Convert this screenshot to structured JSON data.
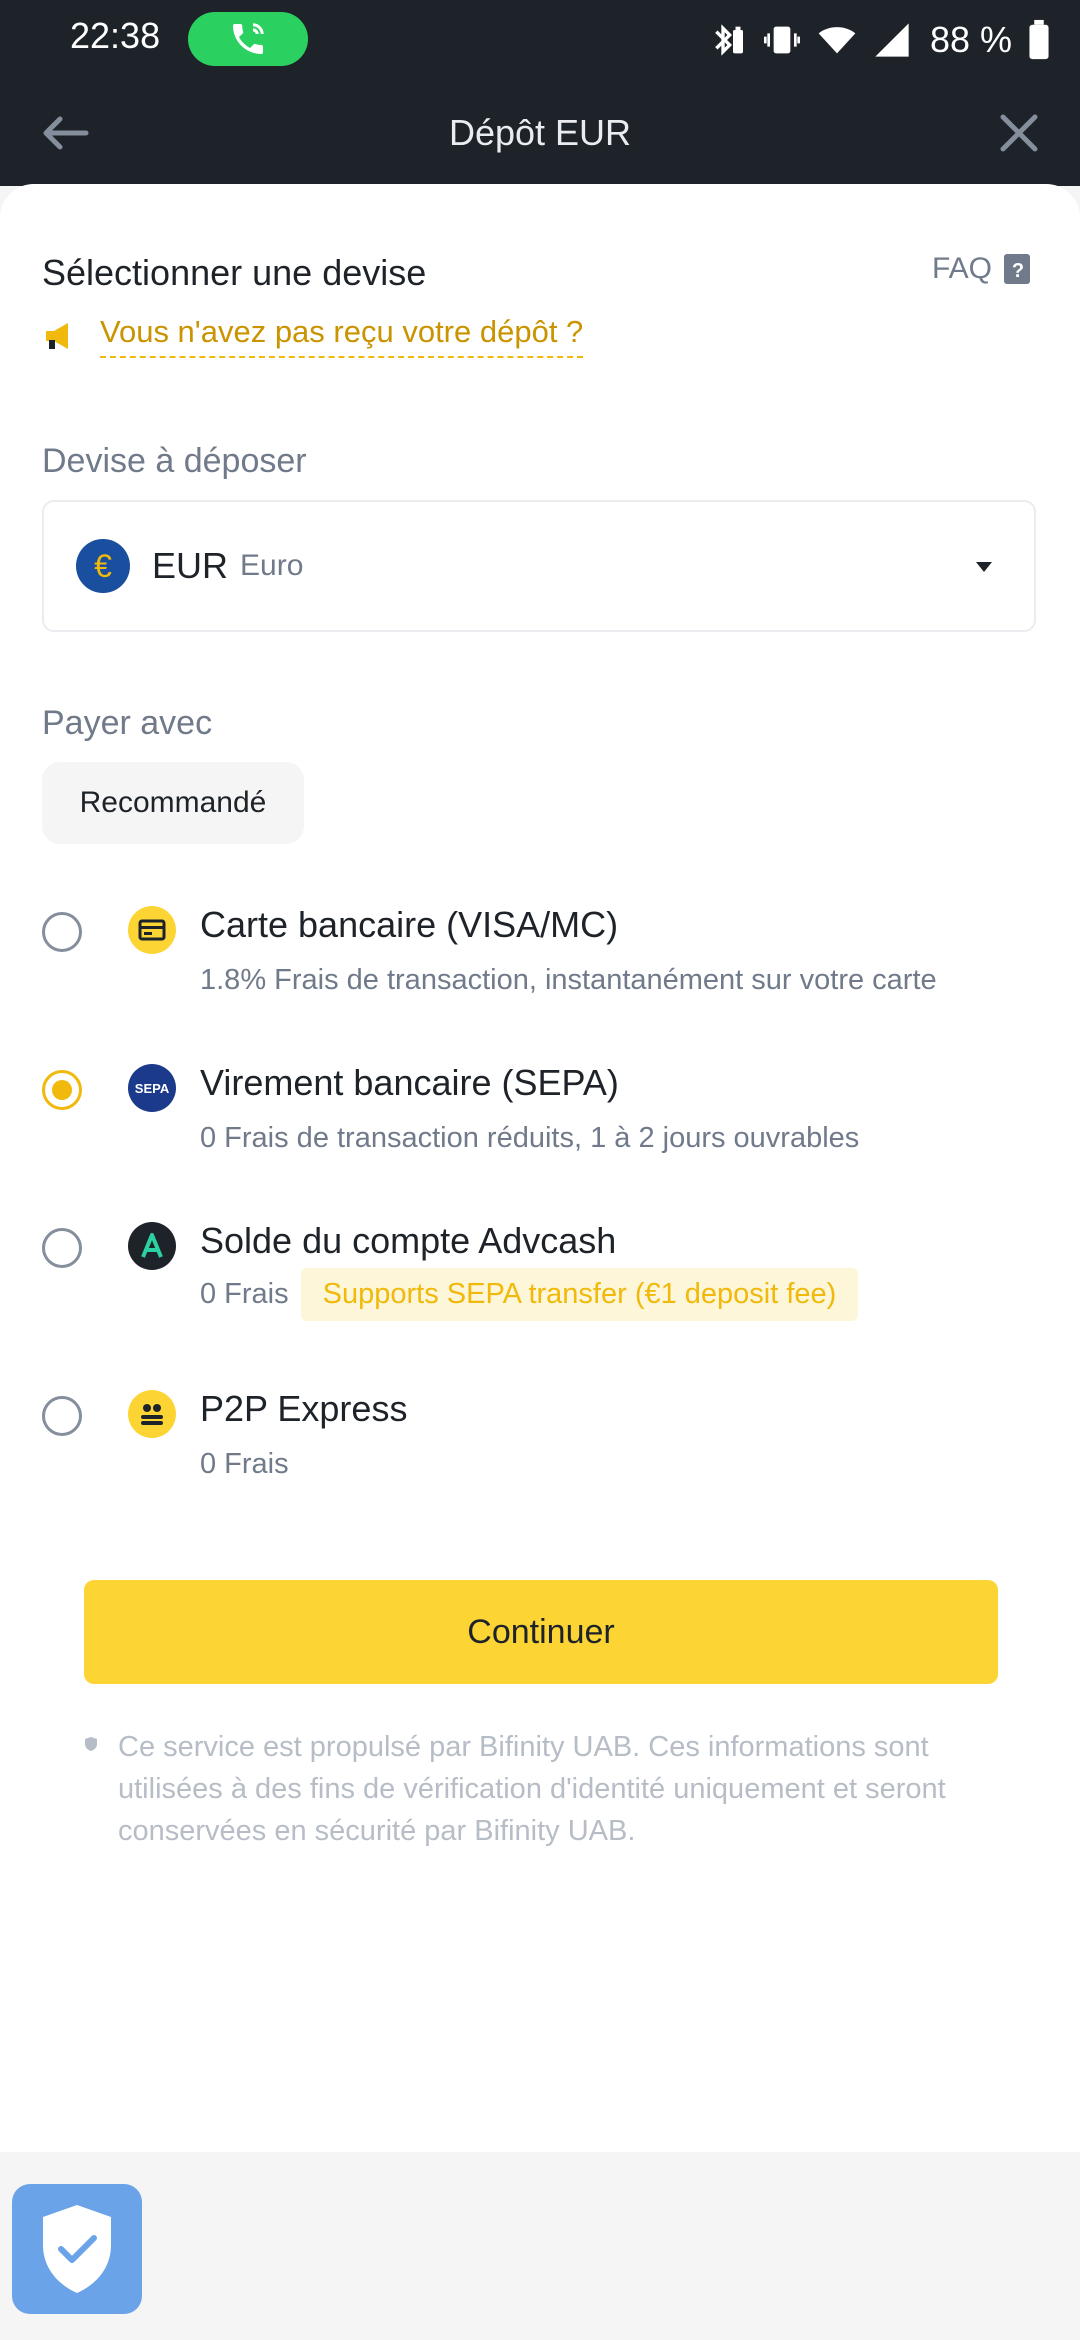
{
  "status_bar": {
    "time": "22:38",
    "battery": "88 %"
  },
  "header": {
    "title": "Dépôt EUR"
  },
  "section": {
    "title": "Sélectionner une devise",
    "faq": "FAQ"
  },
  "notice": {
    "text": "Vous n'avez pas reçu votre dépôt ?"
  },
  "currency": {
    "label": "Devise à déposer",
    "code": "EUR",
    "name": "Euro",
    "symbol": "€"
  },
  "payment": {
    "label": "Payer avec",
    "chip": "Recommandé",
    "options": [
      {
        "title": "Carte bancaire (VISA/MC)",
        "desc": "1.8% Frais de transaction, instantanément sur votre carte",
        "checked": false
      },
      {
        "title": "Virement bancaire (SEPA)",
        "desc": "0 Frais de transaction réduits, 1 à 2 jours ouvrables",
        "checked": true,
        "icon_text": "SEPA"
      },
      {
        "title": "Solde du compte Advcash",
        "desc": "0 Frais",
        "badge": "Supports SEPA transfer (€1 deposit fee)",
        "checked": false
      },
      {
        "title": "P2P Express",
        "desc": "0 Frais",
        "checked": false
      }
    ]
  },
  "actions": {
    "continue": "Continuer"
  },
  "disclaimer": {
    "text": "Ce service est propulsé par Bifinity UAB. Ces informations sont utilisées à des fins de vérification d'identité uniquement et seront conservées en sécurité par Bifinity UAB."
  },
  "colors": {
    "accent": "#fcd535",
    "dark_header": "#1e2329",
    "link": "#c99400",
    "text_secondary": "#707a8a"
  }
}
